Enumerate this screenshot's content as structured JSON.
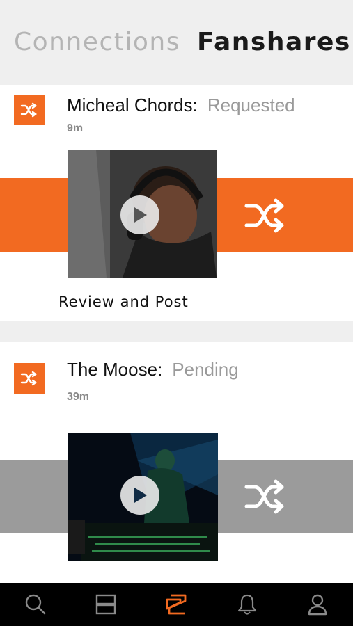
{
  "tabs": [
    {
      "label": "Connections",
      "active": false
    },
    {
      "label": "Fanshares",
      "active": true
    }
  ],
  "accent_color": "#f26a21",
  "pending_color": "#9b9b9b",
  "feed": [
    {
      "name": "Micheal Chords:",
      "status": "Requested",
      "time": "9m",
      "action_label": "Review and Post",
      "band_color": "#f26a21",
      "thumbnail": "man-with-headphones-in-studio",
      "icons": {
        "badge": "shuffle-icon",
        "play": "play-icon",
        "share": "shuffle-icon"
      }
    },
    {
      "name": "The Moose:",
      "status": "Pending",
      "time": "39m",
      "band_color": "#9b9b9b",
      "thumbnail": "dj-at-turntables-blue-light",
      "icons": {
        "badge": "shuffle-icon",
        "play": "play-icon",
        "share": "shuffle-icon"
      }
    }
  ],
  "bottom_nav": [
    {
      "icon": "search-icon",
      "active": false
    },
    {
      "icon": "feed-icon",
      "active": false
    },
    {
      "icon": "fanshare-icon",
      "active": true
    },
    {
      "icon": "bell-icon",
      "active": false
    },
    {
      "icon": "profile-icon",
      "active": false
    }
  ]
}
